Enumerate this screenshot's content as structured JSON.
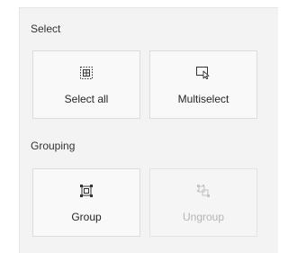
{
  "sections": {
    "select": {
      "label": "Select",
      "buttons": {
        "select_all": {
          "label": "Select all",
          "icon": "select-all-icon",
          "enabled": true
        },
        "multiselect": {
          "label": "Multiselect",
          "icon": "multiselect-icon",
          "enabled": true
        }
      }
    },
    "grouping": {
      "label": "Grouping",
      "buttons": {
        "group": {
          "label": "Group",
          "icon": "group-icon",
          "enabled": true
        },
        "ungroup": {
          "label": "Ungroup",
          "icon": "ungroup-icon",
          "enabled": false
        }
      }
    }
  },
  "colors": {
    "panel_background": "#f3f3f3",
    "tile_background": "#f9f9f9",
    "tile_border": "#dcdcdc",
    "text": "#262626",
    "disabled_text": "#b5b5b5"
  }
}
